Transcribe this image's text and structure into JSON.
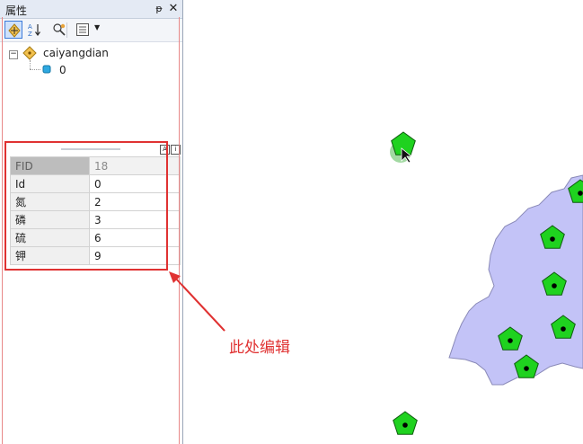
{
  "panel": {
    "title": "属性",
    "pin_glyph": "ᵽ",
    "close_glyph": "✕"
  },
  "toolbar": {
    "tools": [
      "feature-list-icon",
      "sort-az-icon",
      "identify-icon",
      "grid-view-icon"
    ]
  },
  "tree": {
    "layer_name": "caiyangdian",
    "feature_id": "0"
  },
  "attributes": {
    "rows": [
      {
        "field": "FID",
        "value": "18"
      },
      {
        "field": "Id",
        "value": "0"
      },
      {
        "field": "氮",
        "value": "2"
      },
      {
        "field": "磷",
        "value": "3"
      },
      {
        "field": "硫",
        "value": "6"
      },
      {
        "field": "钾",
        "value": "9"
      }
    ]
  },
  "annotation": {
    "text": "此处编辑",
    "color": "#e03232"
  },
  "map": {
    "polygon_fill": "#c3c3f7",
    "polygon_stroke": "#8a8ab8",
    "marker_fill": "#1fd21f",
    "marker_stroke": "#0f5c0f"
  }
}
